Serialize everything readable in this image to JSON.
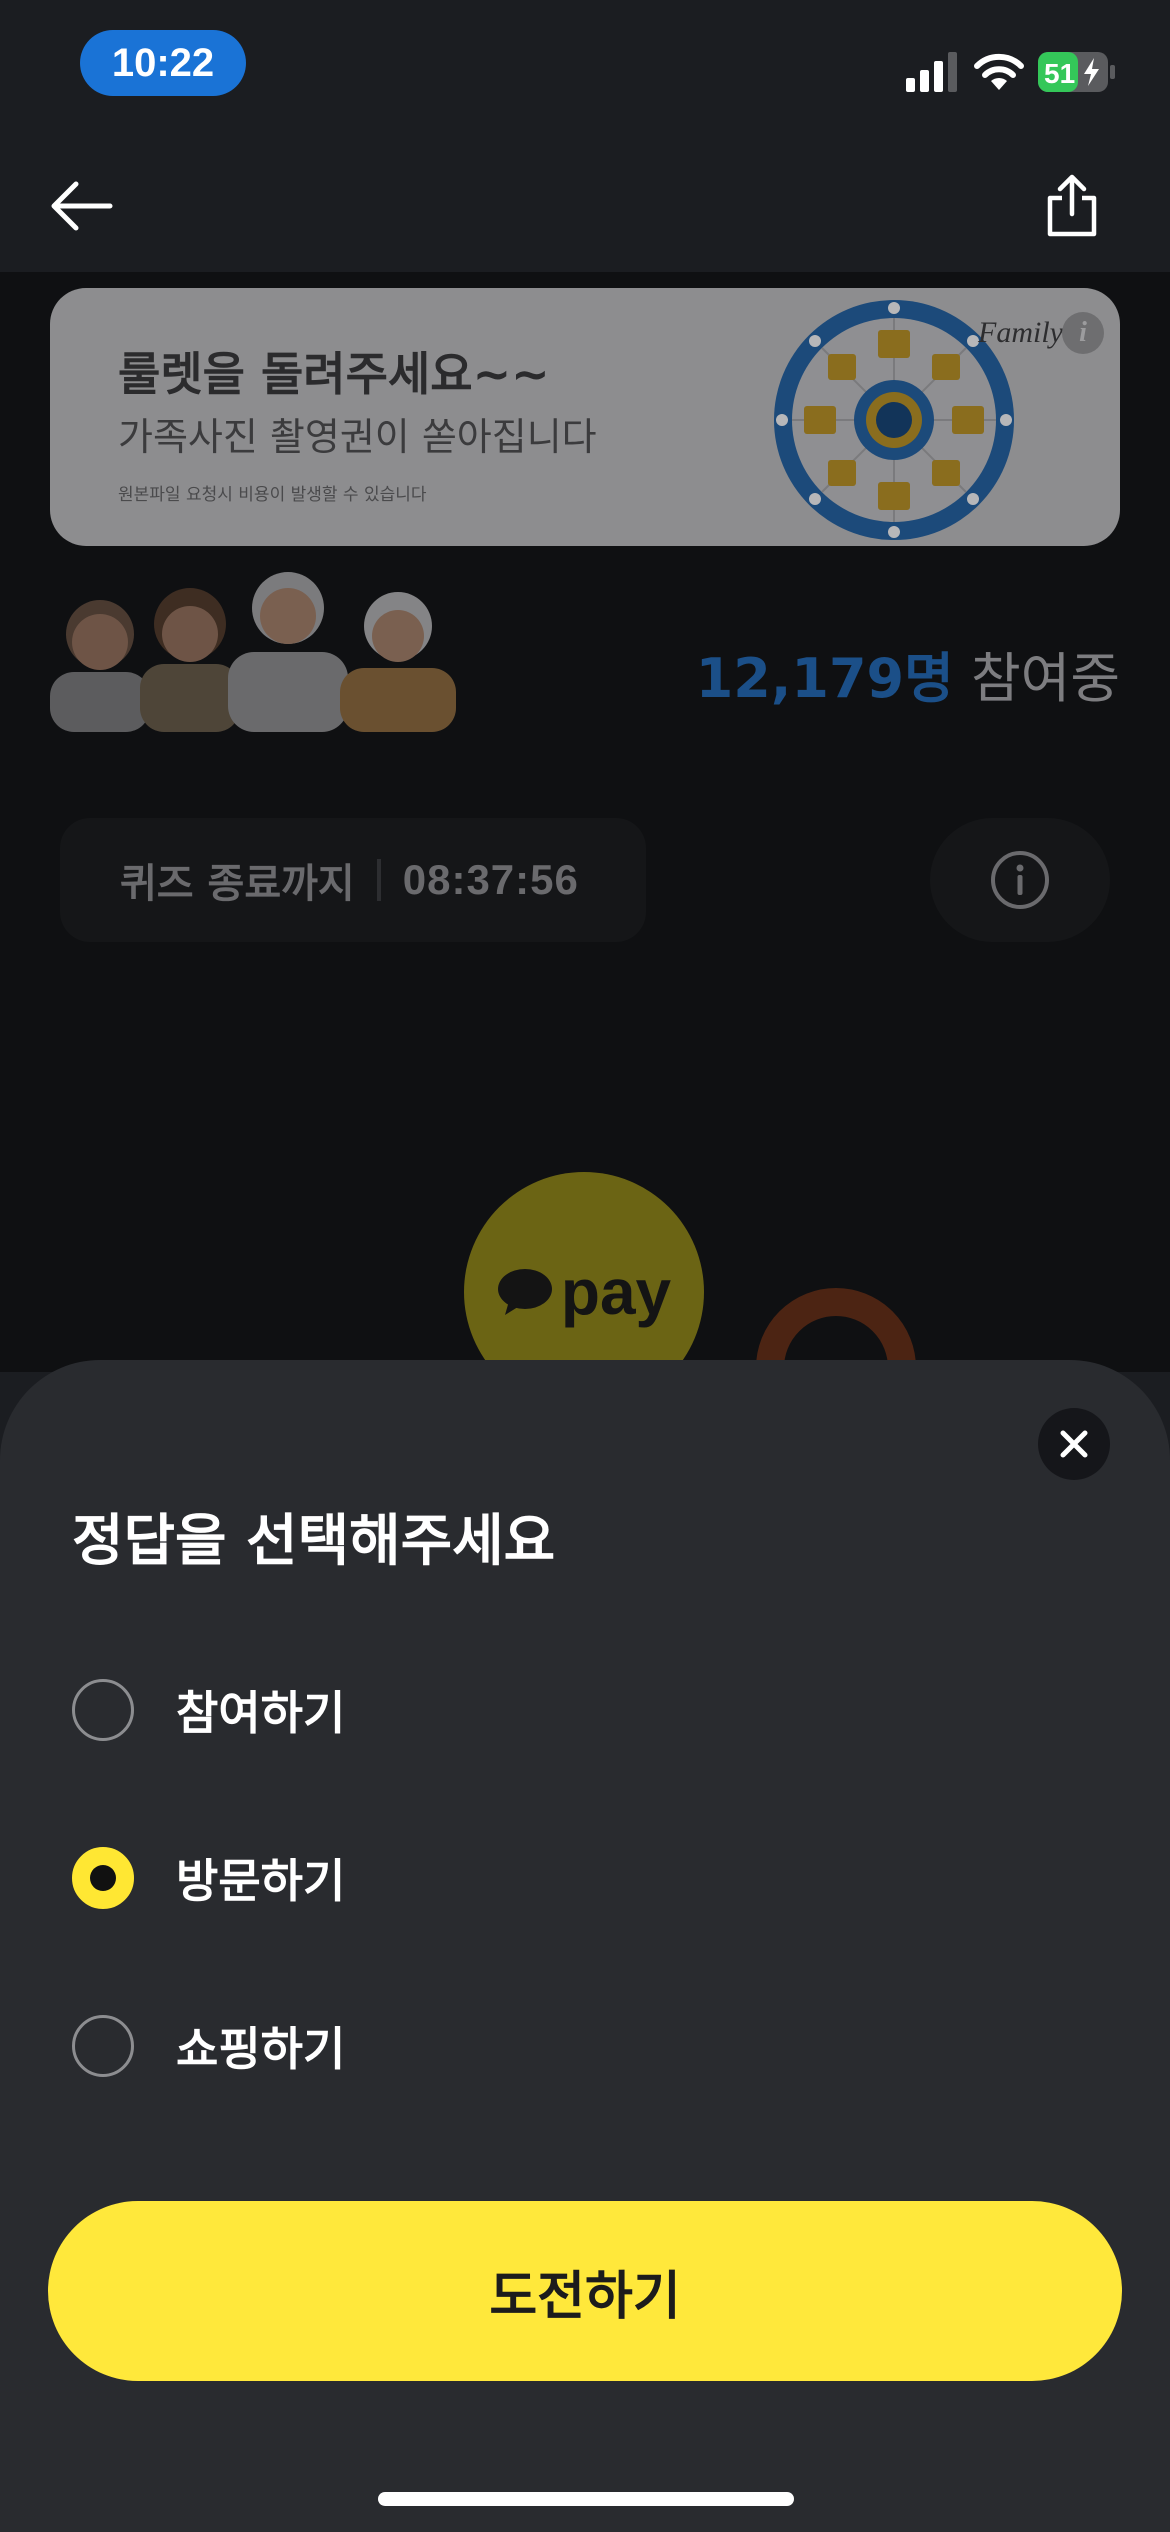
{
  "status_bar": {
    "time": "10:22",
    "battery_level": "51",
    "icons": [
      "signal-icon",
      "wifi-icon",
      "battery-charging-icon"
    ]
  },
  "nav": {
    "icons": [
      "back-arrow-icon",
      "share-icon"
    ]
  },
  "banner": {
    "title": "룰렛을 돌려주세요~~",
    "subtitle": "가족사진 촬영권이 쏟아집니다",
    "note": "원본파일 요청시 비용이 발생할 수 있습니다",
    "brand": "Family U",
    "info_icon_text": "i"
  },
  "participants": {
    "count": "12,179명",
    "label": "참여중"
  },
  "quiz_timer": {
    "label": "퀴즈 종료까지",
    "value": "08:37:56"
  },
  "pay_badge": {
    "text": "pay"
  },
  "answer_sheet": {
    "title": "정답을 선택해주세요",
    "options": [
      {
        "label": "참여하기",
        "selected": false
      },
      {
        "label": "방문하기",
        "selected": true
      },
      {
        "label": "쇼핑하기",
        "selected": false
      }
    ],
    "submit_label": "도전하기"
  },
  "colors": {
    "accent_yellow": "#ffe83b",
    "time_pill_blue": "#1a73d6",
    "sheet_bg": "#292b2f"
  }
}
